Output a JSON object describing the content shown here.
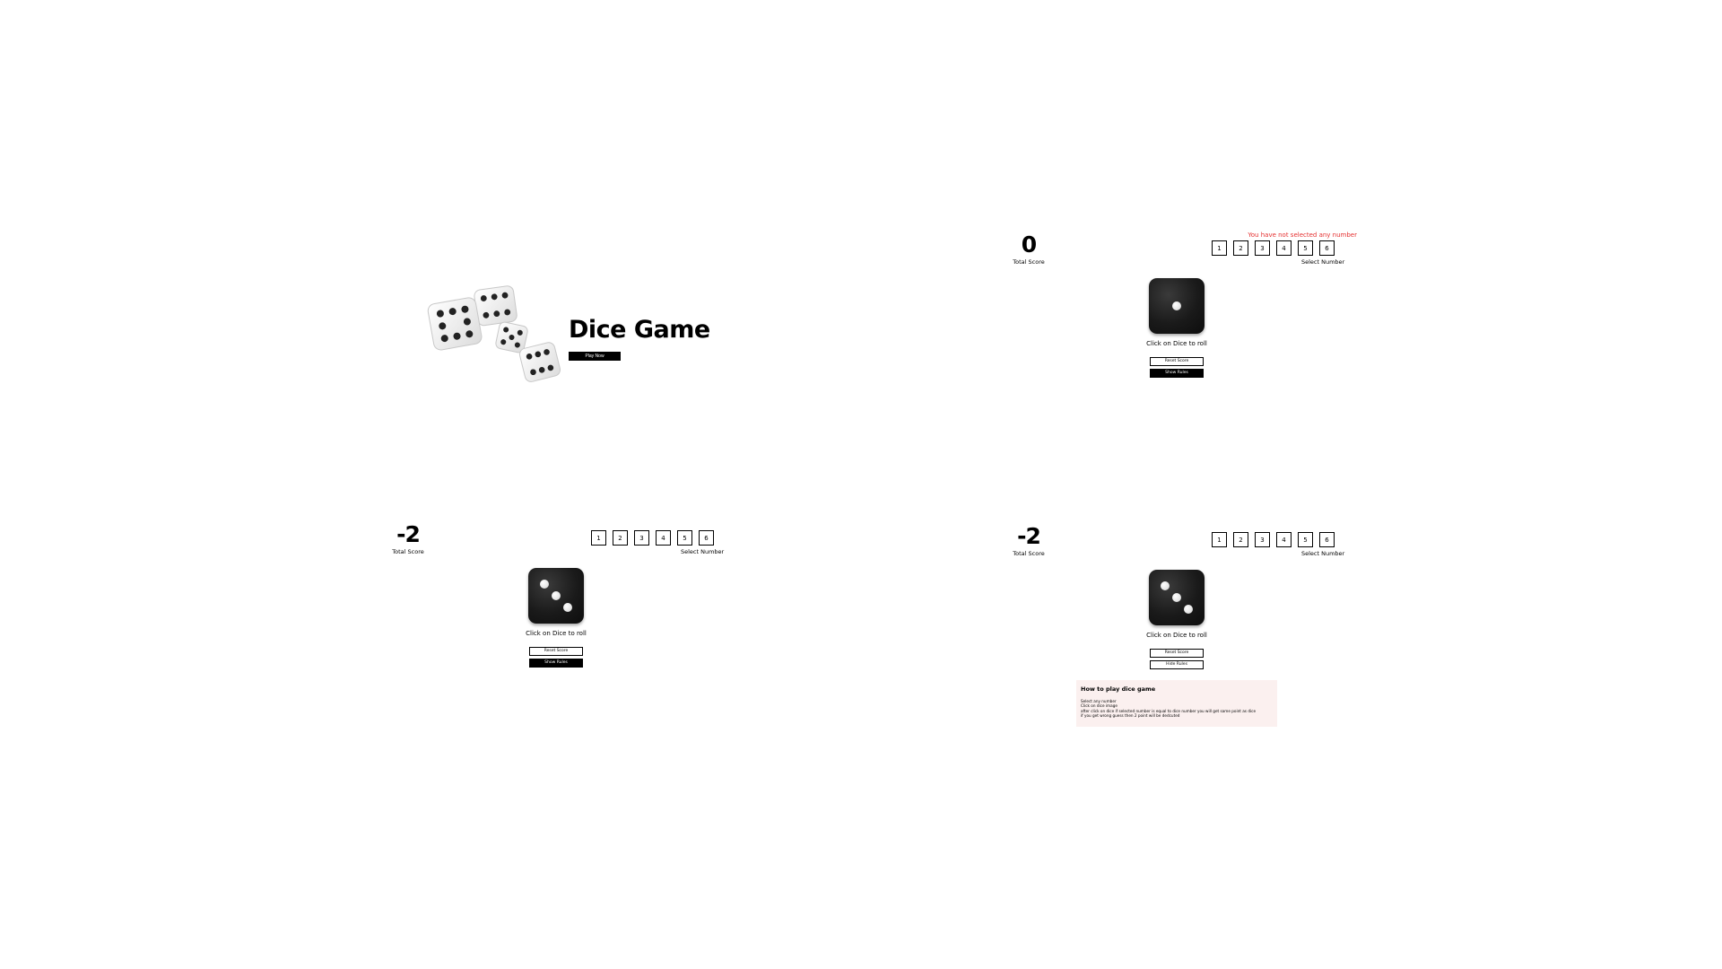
{
  "intro": {
    "title": "Dice Game",
    "play_button": "Play Now"
  },
  "game_panels": [
    {
      "score": "0",
      "score_label": "Total Score",
      "error": "You have not selected any number",
      "numbers": [
        "1",
        "2",
        "3",
        "4",
        "5",
        "6"
      ],
      "select_label": "Select Number",
      "die_value": 1,
      "roll_hint": "Click on Dice to roll",
      "reset_button": "Reset Score",
      "rules_button": "Show Rules"
    },
    {
      "score": "-2",
      "score_label": "Total Score",
      "numbers": [
        "1",
        "2",
        "3",
        "4",
        "5",
        "6"
      ],
      "select_label": "Select Number",
      "die_value": 3,
      "roll_hint": "Click on Dice to roll",
      "reset_button": "Reset Score",
      "rules_button": "Show Rules"
    },
    {
      "score": "-2",
      "score_label": "Total Score",
      "numbers": [
        "1",
        "2",
        "3",
        "4",
        "5",
        "6"
      ],
      "select_label": "Select Number",
      "die_value": 3,
      "roll_hint": "Click on Dice to roll",
      "reset_button": "Reset Score",
      "rules_button": "Hide Rules",
      "rules": {
        "title": "How to play dice game",
        "lines": [
          "Select any number",
          "Click on dice image",
          "after click on dice if selected number is equal to dice number you will get same point as dice",
          "if you get wrong guess then 2 point will be dedcuted"
        ]
      }
    }
  ]
}
